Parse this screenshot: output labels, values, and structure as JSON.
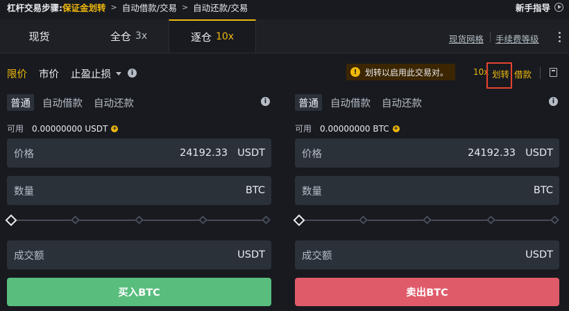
{
  "breadcrumb": {
    "title": "杠杆交易步骤:",
    "highlight": "保证金划转",
    "step2": "自动借款/交易",
    "step3": "自动还款/交易"
  },
  "guide": {
    "label": "新手指导"
  },
  "tabs": [
    {
      "label": "现货",
      "leverage": ""
    },
    {
      "label": "全仓",
      "leverage": "3x"
    },
    {
      "label": "逐仓",
      "leverage": "10x",
      "active": true
    }
  ],
  "header_links": {
    "spot_grid": "现货网格",
    "fee_level": "手续费等级"
  },
  "order_types": {
    "limit": "限价",
    "market": "市价",
    "stop": "止盈止损"
  },
  "notice": {
    "text": "划转以启用此交易对。"
  },
  "margin_actions": {
    "leverage": "10x",
    "transfer": "划转",
    "borrow": "借款"
  },
  "buy_panel": {
    "modes": [
      "普通",
      "自动借款",
      "自动还款"
    ],
    "avail_label": "可用",
    "avail_value": "0.00000000 USDT",
    "price_label": "价格",
    "price_value": "24192.33",
    "price_unit": "USDT",
    "qty_label": "数量",
    "qty_unit": "BTC",
    "total_label": "成交额",
    "total_unit": "USDT",
    "button": "买入BTC"
  },
  "sell_panel": {
    "modes": [
      "普通",
      "自动借款",
      "自动还款"
    ],
    "avail_label": "可用",
    "avail_value": "0.00000000 BTC",
    "price_label": "价格",
    "price_value": "24192.33",
    "price_unit": "USDT",
    "qty_label": "数量",
    "qty_unit": "BTC",
    "total_label": "成交额",
    "total_unit": "USDT",
    "button": "卖出BTC"
  },
  "colors": {
    "accent": "#f0b90b",
    "buy": "#58bd7d",
    "sell": "#e05b6a",
    "bg": "#181a20",
    "field": "#2b3139"
  }
}
